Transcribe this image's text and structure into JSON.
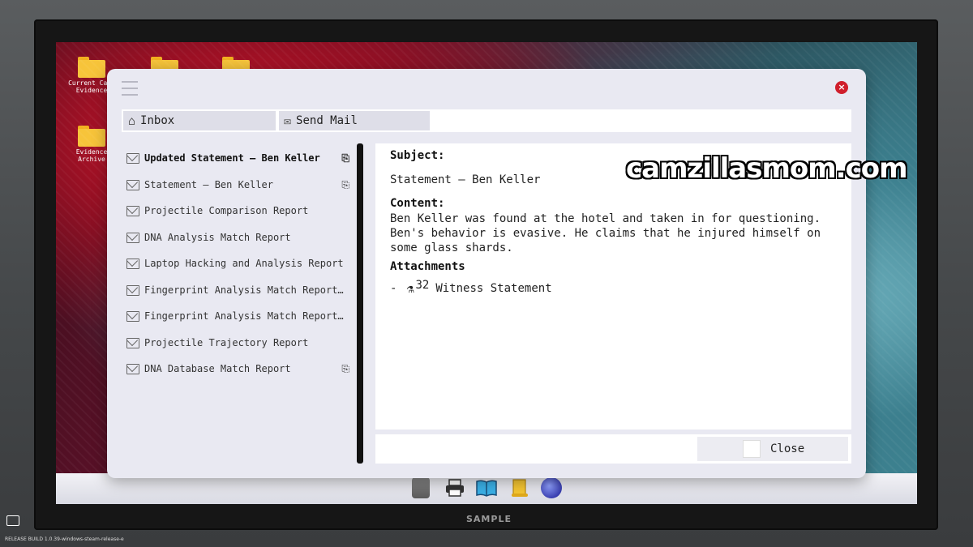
{
  "desktop": {
    "icons": [
      {
        "label": "Current Case Evidence"
      },
      {
        "label": "Evidence Archive"
      }
    ]
  },
  "mail": {
    "tabs": [
      {
        "label": "Inbox",
        "icon": "inbox-icon"
      },
      {
        "label": "Send Mail",
        "icon": "envelope-icon"
      }
    ],
    "messages": [
      {
        "subject": "Updated Statement — Ben Keller",
        "bold": true,
        "attachment": true
      },
      {
        "subject": "Statement — Ben Keller",
        "bold": false,
        "attachment": true
      },
      {
        "subject": "Projectile Comparison Report",
        "bold": false,
        "attachment": false
      },
      {
        "subject": "DNA Analysis Match Report",
        "bold": false,
        "attachment": false
      },
      {
        "subject": "Laptop Hacking and Analysis Report",
        "bold": false,
        "attachment": false
      },
      {
        "subject": "Fingerprint Analysis Match Report — …",
        "bold": false,
        "attachment": false
      },
      {
        "subject": "Fingerprint Analysis Match Report — …",
        "bold": false,
        "attachment": false
      },
      {
        "subject": "Projectile Trajectory Report",
        "bold": false,
        "attachment": false
      },
      {
        "subject": "DNA Database Match Report",
        "bold": false,
        "attachment": true
      }
    ],
    "detail": {
      "subject_label": "Subject:",
      "subject": "Statement — Ben Keller",
      "content_label": "Content:",
      "content": "Ben Keller was found at the hotel and taken in for questioning. Ben's behavior is evasive. He claims that he injured himself on some glass shards.",
      "attachments_label": "Attachments",
      "attachment_prefix": "-",
      "attachment_id": "32",
      "attachment_name": "Witness Statement",
      "attachment_icon": "microscope-icon"
    },
    "close_label": "Close"
  },
  "taskbar": {
    "icons": [
      "trash-icon",
      "printer-icon",
      "book-icon",
      "scroll-icon",
      "globe-icon"
    ]
  },
  "overlay": {
    "watermark": "camzillasmom.com",
    "sample_label": "SAMPLE",
    "build_label": "RELEASE  BUILD 1.0.39-windows-steam-release-e"
  },
  "colors": {
    "close_red": "#d01f2c",
    "window_bg": "#e9e9f2",
    "folder_yellow": "#f7c43a"
  }
}
